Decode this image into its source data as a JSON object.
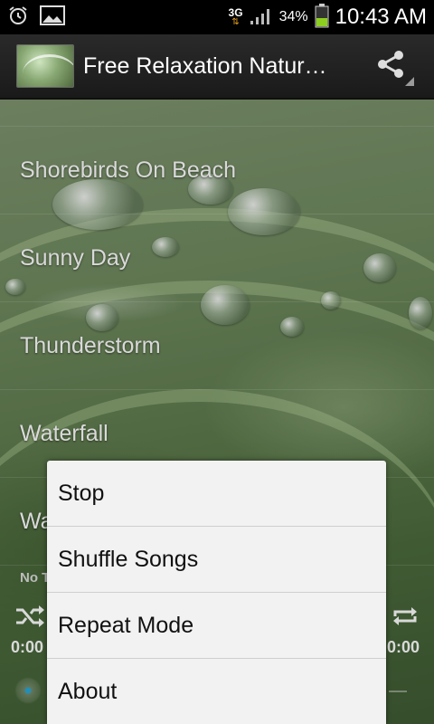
{
  "status_bar": {
    "network": "3G",
    "battery_percent": "34%",
    "time": "10:43 AM",
    "icons": [
      "alarm-icon",
      "image-icon",
      "network-arrows-icon",
      "signal-icon",
      "battery-icon"
    ]
  },
  "action_bar": {
    "title": "Free Relaxation Natur…",
    "share_icon": "share-icon"
  },
  "songs": [
    {
      "label": "Shorebirds On Beach"
    },
    {
      "label": "Sunny Day"
    },
    {
      "label": "Thunderstorm"
    },
    {
      "label": "Waterfall"
    },
    {
      "label": "Wa"
    }
  ],
  "player": {
    "now_playing": "No T",
    "elapsed": "0:00",
    "total": "0:00",
    "shuffle_icon": "shuffle-icon",
    "repeat_icon": "repeat-icon"
  },
  "menu": {
    "items": [
      {
        "label": "Stop"
      },
      {
        "label": "Shuffle Songs"
      },
      {
        "label": "Repeat Mode"
      },
      {
        "label": "About"
      }
    ]
  },
  "colors": {
    "status_bar_bg": "#000000",
    "action_bar_bg": "#1f1f1f",
    "menu_bg": "#f2f2f2",
    "battery_fill": "#8ccf1e",
    "network_arrows": "#e8a020",
    "seek_dot": "#2aa7d8"
  }
}
